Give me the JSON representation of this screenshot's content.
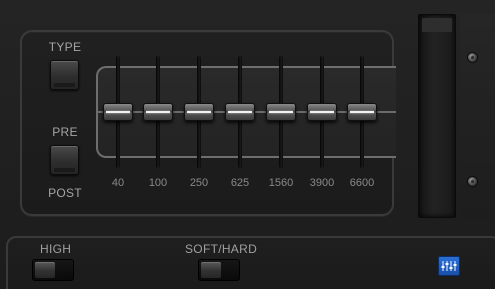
{
  "eq": {
    "type_label": "TYPE",
    "pre_label": "PRE",
    "post_label": "POST",
    "bands": [
      {
        "freq": "40",
        "gain": 0
      },
      {
        "freq": "100",
        "gain": 0
      },
      {
        "freq": "250",
        "gain": 0
      },
      {
        "freq": "625",
        "gain": 0
      },
      {
        "freq": "1560",
        "gain": 0
      },
      {
        "freq": "3900",
        "gain": 0
      },
      {
        "freq": "6600",
        "gain": 0
      }
    ]
  },
  "bottom": {
    "high_label": "HIGH",
    "soft_hard_label": "SOFT/HARD"
  },
  "colors": {
    "accent": "#2a6fd6",
    "thumb_line": "#f2f2f2",
    "frame": "#6e6e6e"
  },
  "icons": {
    "eq_button": "eq-sliders-icon",
    "screw": "screw-icon"
  }
}
